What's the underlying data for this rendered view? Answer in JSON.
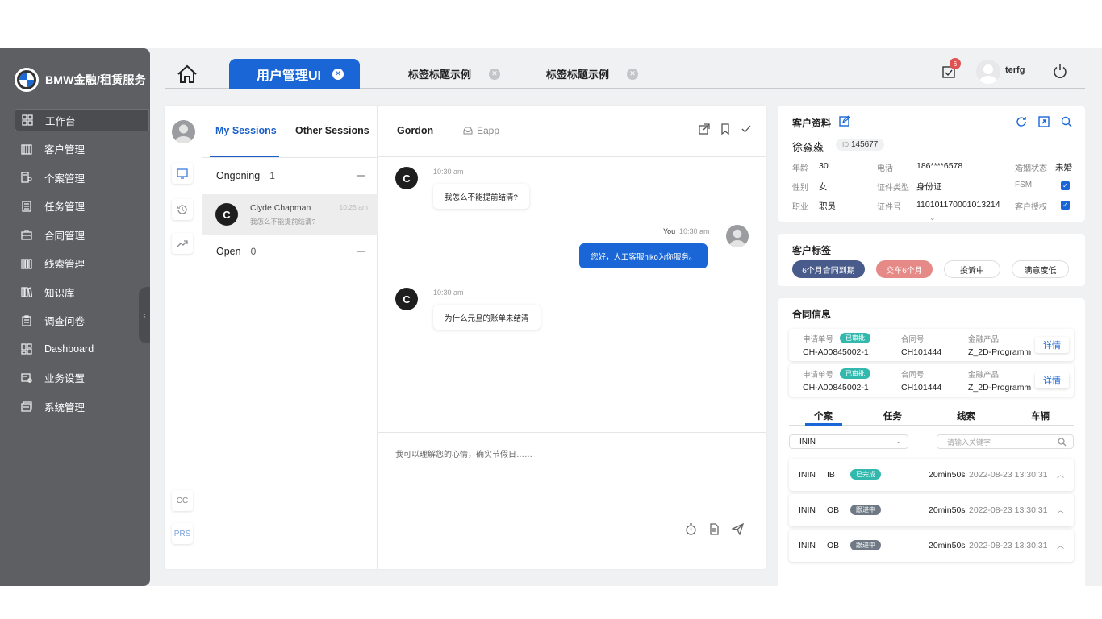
{
  "brand": {
    "name": "BMW金融/租赁服务"
  },
  "nav": [
    {
      "label": "工作台",
      "icon": "grid-icon"
    },
    {
      "label": "客户管理",
      "icon": "building-icon"
    },
    {
      "label": "个案管理",
      "icon": "file-user-icon"
    },
    {
      "label": "任务管理",
      "icon": "list-icon"
    },
    {
      "label": "合同管理",
      "icon": "briefcase-icon"
    },
    {
      "label": "线索管理",
      "icon": "bars-icon"
    },
    {
      "label": "知识库",
      "icon": "books-icon"
    },
    {
      "label": "调查问卷",
      "icon": "clipboard-icon"
    },
    {
      "label": "Dashboard",
      "icon": "dashboard-icon"
    },
    {
      "label": "业务设置",
      "icon": "settings-card-icon"
    },
    {
      "label": "系统管理",
      "icon": "stack-icon"
    }
  ],
  "tabs": {
    "active": "用户管理UI",
    "items": [
      "标签标题示例",
      "标签标题示例"
    ],
    "close_glyph": "✕"
  },
  "header": {
    "notification_count": "6",
    "user_name": "terfg"
  },
  "rail": {
    "cc": "CC",
    "prs": "PRS"
  },
  "sessions": {
    "tab_mine": "My Sessions",
    "tab_other": "Other Sessions",
    "ongoing_label": "Ongoning",
    "ongoing_count": "1",
    "open_label": "Open",
    "open_count": "0",
    "item": {
      "initial": "C",
      "name": "Clyde Chapman",
      "time": "10:25 am",
      "preview": "我怎么不能提前结清?"
    }
  },
  "conversation": {
    "name": "Gordon",
    "channel": "Eapp",
    "messages": [
      {
        "initial": "C",
        "time": "10:30 am",
        "text": "我怎么不能提前结清?"
      },
      {
        "sender": "You",
        "time": "10:30 am",
        "text": "您好，人工客服niko为你服务。"
      },
      {
        "initial": "C",
        "time": "10:30 am",
        "text": "为什么元旦的账单未结清"
      }
    ],
    "composer_text": "我可以理解您的心情，确实节假日……"
  },
  "customer": {
    "title": "客户资料",
    "name": "徐淼淼",
    "id_label": "ID",
    "id_value": "145677",
    "fields": {
      "age_label": "年龄",
      "age": "30",
      "phone_label": "电话",
      "phone": "186****6578",
      "marital_label": "婚姻状态",
      "marital": "未婚",
      "gender_label": "性别",
      "gender": "女",
      "idtype_label": "证件类型",
      "idtype": "身份证",
      "fsm_label": "FSM",
      "job_label": "职业",
      "job": "职员",
      "idno_label": "证件号",
      "idno": "110101170001013214",
      "auth_label": "客户授权"
    }
  },
  "tags": {
    "title": "客户标签",
    "items": [
      "6个月合同到期",
      "交车6个月",
      "投诉中",
      "满意度低"
    ]
  },
  "contract": {
    "title": "合同信息",
    "rows": [
      {
        "app_label": "申请单号",
        "status": "已审批",
        "app_no": "CH-A00845002-1",
        "contract_label": "合同号",
        "contract_no": "CH101444",
        "product_label": "金融产品",
        "product": "Z_2D-Programm",
        "action": "详情"
      },
      {
        "app_label": "申请单号",
        "status": "已审批",
        "app_no": "CH-A00845002-1",
        "contract_label": "合同号",
        "contract_no": "CH101444",
        "product_label": "金融产品",
        "product": "Z_2D-Programm",
        "action": "详情"
      }
    ],
    "tabs": [
      "个案",
      "任务",
      "线索",
      "车辆"
    ],
    "filter_value": "ININ",
    "search_placeholder": "请输入关键字",
    "cases": [
      {
        "src": "ININ",
        "dir": "IB",
        "status": "已完成",
        "status_color": "#33b8ad",
        "duration": "20min50s",
        "timestamp": "2022-08-23 13:30:31"
      },
      {
        "src": "ININ",
        "dir": "OB",
        "status": "跟进中",
        "status_color": "#6f7985",
        "duration": "20min50s",
        "timestamp": "2022-08-23 13:30:31"
      },
      {
        "src": "ININ",
        "dir": "OB",
        "status": "跟进中",
        "status_color": "#6f7985",
        "duration": "20min50s",
        "timestamp": "2022-08-23 13:30:31"
      }
    ]
  },
  "colors": {
    "accent": "#1a66d6",
    "sidebar": "#5d5f63",
    "green": "#33b8ad",
    "tag_navy": "#485b8a",
    "tag_pink": "#e58a87"
  }
}
